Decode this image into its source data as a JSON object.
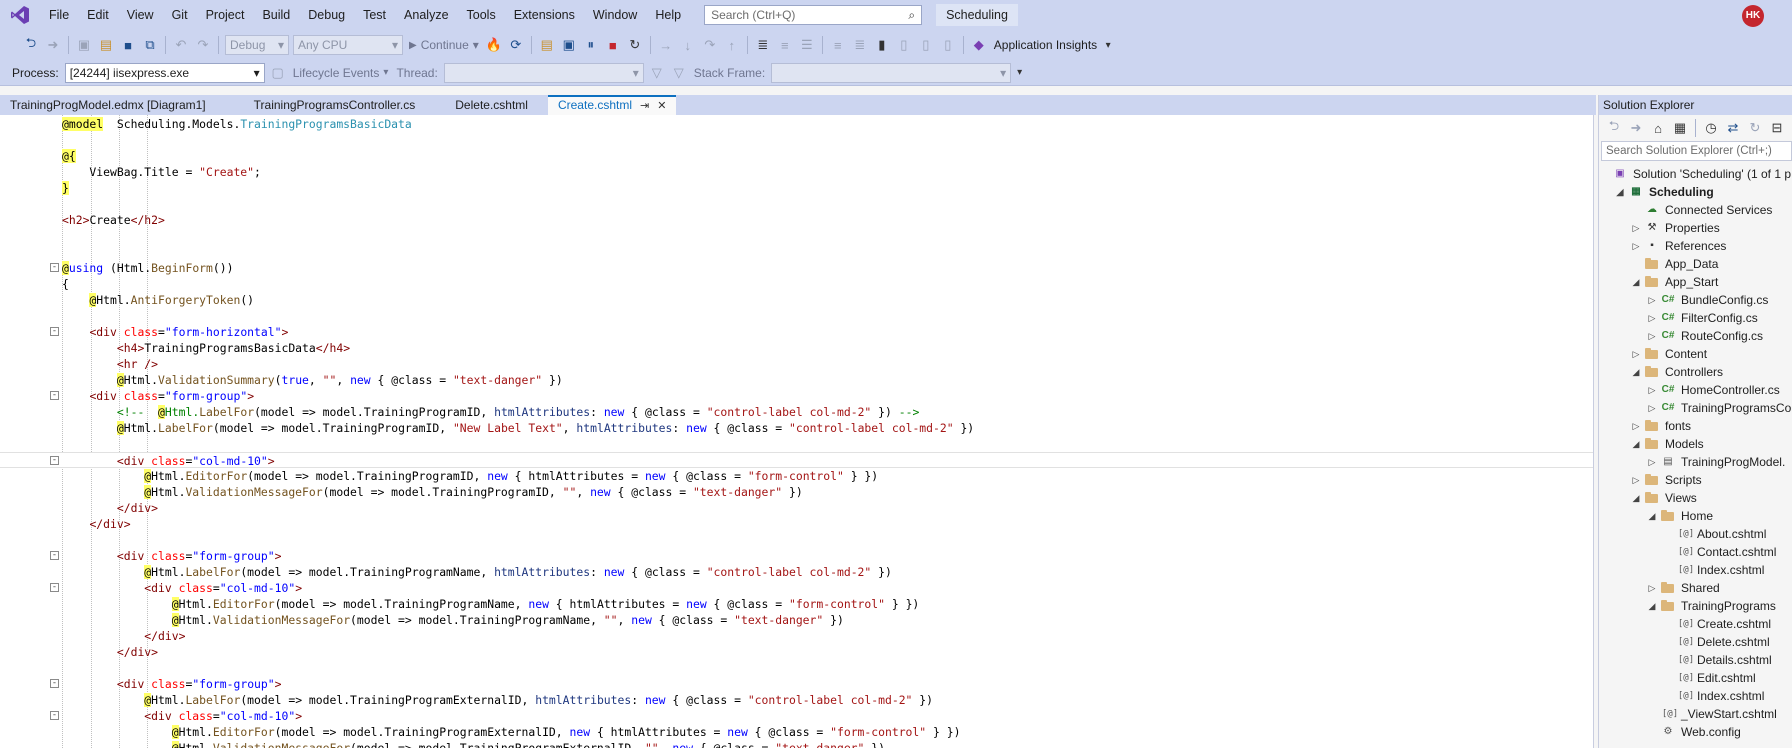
{
  "menubar": {
    "items": [
      "File",
      "Edit",
      "View",
      "Git",
      "Project",
      "Build",
      "Debug",
      "Test",
      "Analyze",
      "Tools",
      "Extensions",
      "Window",
      "Help"
    ],
    "search_placeholder": "Search (Ctrl+Q)",
    "solution_name": "Scheduling",
    "user_initials": "HK"
  },
  "toolbar": {
    "config": "Debug",
    "platform": "Any CPU",
    "continue_label": "Continue",
    "app_insights": "Application Insights",
    "process_label": "Process:",
    "process_value": "[24244] iisexpress.exe",
    "lifecycle": "Lifecycle Events",
    "thread_label": "Thread:",
    "stack_label": "Stack Frame:"
  },
  "tabs": [
    {
      "label": "TrainingProgModel.edmx [Diagram1]",
      "active": false
    },
    {
      "label": "TrainingProgramsController.cs",
      "active": false
    },
    {
      "label": "Delete.cshtml",
      "active": false
    },
    {
      "label": "Create.cshtml",
      "active": true
    }
  ],
  "tab_icons": {
    "pin": "pin-icon",
    "close": "close-icon"
  },
  "solution_explorer": {
    "title": "Solution Explorer",
    "search_placeholder": "Search Solution Explorer (Ctrl+;)",
    "nodes": [
      {
        "label": "Solution 'Scheduling' (1 of 1 p",
        "depth": 0,
        "exp": "",
        "icon": "solution"
      },
      {
        "label": "Scheduling",
        "depth": 1,
        "exp": "open",
        "icon": "project",
        "selected": true
      },
      {
        "label": "Connected Services",
        "depth": 2,
        "exp": "",
        "icon": "cloud"
      },
      {
        "label": "Properties",
        "depth": 2,
        "exp": "closed",
        "icon": "wrench"
      },
      {
        "label": "References",
        "depth": 2,
        "exp": "closed",
        "icon": "refs"
      },
      {
        "label": "App_Data",
        "depth": 2,
        "exp": "",
        "icon": "folder"
      },
      {
        "label": "App_Start",
        "depth": 2,
        "exp": "open",
        "icon": "folder"
      },
      {
        "label": "BundleConfig.cs",
        "depth": 3,
        "exp": "closed",
        "icon": "cs"
      },
      {
        "label": "FilterConfig.cs",
        "depth": 3,
        "exp": "closed",
        "icon": "cs"
      },
      {
        "label": "RouteConfig.cs",
        "depth": 3,
        "exp": "closed",
        "icon": "cs"
      },
      {
        "label": "Content",
        "depth": 2,
        "exp": "closed",
        "icon": "folder"
      },
      {
        "label": "Controllers",
        "depth": 2,
        "exp": "open",
        "icon": "folder"
      },
      {
        "label": "HomeController.cs",
        "depth": 3,
        "exp": "closed",
        "icon": "cs"
      },
      {
        "label": "TrainingProgramsCo",
        "depth": 3,
        "exp": "closed",
        "icon": "cs"
      },
      {
        "label": "fonts",
        "depth": 2,
        "exp": "closed",
        "icon": "folder"
      },
      {
        "label": "Models",
        "depth": 2,
        "exp": "open",
        "icon": "folder"
      },
      {
        "label": "TrainingProgModel.",
        "depth": 3,
        "exp": "closed",
        "icon": "edmx"
      },
      {
        "label": "Scripts",
        "depth": 2,
        "exp": "closed",
        "icon": "folder"
      },
      {
        "label": "Views",
        "depth": 2,
        "exp": "open",
        "icon": "folder"
      },
      {
        "label": "Home",
        "depth": 3,
        "exp": "open",
        "icon": "folder"
      },
      {
        "label": "About.cshtml",
        "depth": 4,
        "exp": "",
        "icon": "razor"
      },
      {
        "label": "Contact.cshtml",
        "depth": 4,
        "exp": "",
        "icon": "razor"
      },
      {
        "label": "Index.cshtml",
        "depth": 4,
        "exp": "",
        "icon": "razor"
      },
      {
        "label": "Shared",
        "depth": 3,
        "exp": "closed",
        "icon": "folder"
      },
      {
        "label": "TrainingPrograms",
        "depth": 3,
        "exp": "open",
        "icon": "folder"
      },
      {
        "label": "Create.cshtml",
        "depth": 4,
        "exp": "",
        "icon": "razor"
      },
      {
        "label": "Delete.cshtml",
        "depth": 4,
        "exp": "",
        "icon": "razor"
      },
      {
        "label": "Details.cshtml",
        "depth": 4,
        "exp": "",
        "icon": "razor"
      },
      {
        "label": "Edit.cshtml",
        "depth": 4,
        "exp": "",
        "icon": "razor"
      },
      {
        "label": "Index.cshtml",
        "depth": 4,
        "exp": "",
        "icon": "razor"
      },
      {
        "label": "_ViewStart.cshtml",
        "depth": 3,
        "exp": "",
        "icon": "razor"
      },
      {
        "label": "Web.config",
        "depth": 3,
        "exp": "",
        "icon": "config"
      }
    ]
  },
  "code_lines": [
    {
      "fold": "",
      "tokens": [
        [
          "at",
          "@model"
        ],
        [
          "",
          "  Scheduling.Models."
        ],
        [
          "type",
          "TrainingProgramsBasicData"
        ]
      ]
    },
    {
      "fold": "",
      "tokens": []
    },
    {
      "fold": "",
      "tokens": [
        [
          "at",
          "@{"
        ]
      ]
    },
    {
      "fold": "",
      "tokens": [
        [
          "",
          "    ViewBag.Title = "
        ],
        [
          "str",
          "\"Create\""
        ],
        [
          "",
          ";"
        ]
      ]
    },
    {
      "fold": "",
      "tokens": [
        [
          "at",
          "}"
        ]
      ]
    },
    {
      "fold": "",
      "tokens": []
    },
    {
      "fold": "",
      "tokens": [
        [
          "tag",
          "<h2>"
        ],
        [
          "",
          "Create"
        ],
        [
          "tag",
          "</h2>"
        ]
      ]
    },
    {
      "fold": "",
      "tokens": []
    },
    {
      "fold": "",
      "tokens": []
    },
    {
      "fold": "-",
      "tokens": [
        [
          "at",
          "@"
        ],
        [
          "kw",
          "using"
        ],
        [
          "",
          " (Html."
        ],
        [
          "method",
          "BeginForm"
        ],
        [
          "",
          "())"
        ]
      ]
    },
    {
      "fold": "",
      "tokens": [
        [
          "",
          "{"
        ]
      ]
    },
    {
      "fold": "",
      "tokens": [
        [
          "",
          "    "
        ],
        [
          "at",
          "@"
        ],
        [
          "",
          "Html."
        ],
        [
          "method",
          "AntiForgeryToken"
        ],
        [
          "",
          "()"
        ]
      ]
    },
    {
      "fold": "",
      "tokens": []
    },
    {
      "fold": "-",
      "tokens": [
        [
          "",
          "    "
        ],
        [
          "tag",
          "<div"
        ],
        [
          "",
          " "
        ],
        [
          "attr",
          "class"
        ],
        [
          "",
          "="
        ],
        [
          "attrval",
          "\"form-horizontal\""
        ],
        [
          "tag",
          ">"
        ]
      ]
    },
    {
      "fold": "",
      "tokens": [
        [
          "",
          "        "
        ],
        [
          "tag",
          "<h4>"
        ],
        [
          "",
          "TrainingProgramsBasicData"
        ],
        [
          "tag",
          "</h4>"
        ]
      ]
    },
    {
      "fold": "",
      "tokens": [
        [
          "",
          "        "
        ],
        [
          "tag",
          "<hr />"
        ]
      ]
    },
    {
      "fold": "",
      "tokens": [
        [
          "",
          "        "
        ],
        [
          "at",
          "@"
        ],
        [
          "",
          "Html."
        ],
        [
          "method",
          "ValidationSummary"
        ],
        [
          "",
          "("
        ],
        [
          "kw",
          "true"
        ],
        [
          "",
          ", "
        ],
        [
          "str",
          "\"\""
        ],
        [
          "",
          ", "
        ],
        [
          "kw",
          "new"
        ],
        [
          "",
          " { @class = "
        ],
        [
          "str",
          "\"text-danger\""
        ],
        [
          "",
          " })"
        ]
      ]
    },
    {
      "fold": "-",
      "tokens": [
        [
          "",
          "    "
        ],
        [
          "tag",
          "<div"
        ],
        [
          "",
          " "
        ],
        [
          "attr",
          "class"
        ],
        [
          "",
          "="
        ],
        [
          "attrval",
          "\"form-group\""
        ],
        [
          "tag",
          ">"
        ]
      ]
    },
    {
      "fold": "",
      "tokens": [
        [
          "",
          "        "
        ],
        [
          "cmt",
          "<!--  "
        ],
        [
          "at",
          "@"
        ],
        [
          "cmt",
          "Html."
        ],
        [
          "method",
          "LabelFor"
        ],
        [
          "",
          "(model => model.TrainingProgramID, "
        ],
        [
          "prop",
          "htmlAttributes"
        ],
        [
          "",
          ": "
        ],
        [
          "kw",
          "new"
        ],
        [
          "",
          " { @class = "
        ],
        [
          "str",
          "\"control-label col-md-2\""
        ],
        [
          "",
          " }) "
        ],
        [
          "cmt",
          "-->"
        ]
      ]
    },
    {
      "fold": "",
      "tokens": [
        [
          "",
          "        "
        ],
        [
          "at",
          "@"
        ],
        [
          "",
          "Html."
        ],
        [
          "method",
          "LabelFor"
        ],
        [
          "",
          "(model => model.TrainingProgramID, "
        ],
        [
          "str",
          "\"New Label Text\""
        ],
        [
          "",
          ", "
        ],
        [
          "prop",
          "htmlAttributes"
        ],
        [
          "",
          ": "
        ],
        [
          "kw",
          "new"
        ],
        [
          "",
          " { @class = "
        ],
        [
          "str",
          "\"control-label col-md-2\""
        ],
        [
          "",
          " })"
        ]
      ]
    },
    {
      "fold": "",
      "tokens": []
    },
    {
      "fold": "-",
      "current": true,
      "tokens": [
        [
          "",
          "        "
        ],
        [
          "tag",
          "<div"
        ],
        [
          "",
          " "
        ],
        [
          "attr",
          "class"
        ],
        [
          "",
          "="
        ],
        [
          "attrval",
          "\"col-md-10\""
        ],
        [
          "tag",
          ">"
        ]
      ]
    },
    {
      "fold": "",
      "tokens": [
        [
          "",
          "            "
        ],
        [
          "at",
          "@"
        ],
        [
          "",
          "Html."
        ],
        [
          "method",
          "EditorFor"
        ],
        [
          "",
          "(model => model.TrainingProgramID, "
        ],
        [
          "kw",
          "new"
        ],
        [
          "",
          " { htmlAttributes = "
        ],
        [
          "kw",
          "new"
        ],
        [
          "",
          " { @class = "
        ],
        [
          "str",
          "\"form-control\""
        ],
        [
          "",
          " } })"
        ]
      ]
    },
    {
      "fold": "",
      "tokens": [
        [
          "",
          "            "
        ],
        [
          "at",
          "@"
        ],
        [
          "",
          "Html."
        ],
        [
          "method",
          "ValidationMessageFor"
        ],
        [
          "",
          "(model => model.TrainingProgramID, "
        ],
        [
          "str",
          "\"\""
        ],
        [
          "",
          ", "
        ],
        [
          "kw",
          "new"
        ],
        [
          "",
          " { @class = "
        ],
        [
          "str",
          "\"text-danger\""
        ],
        [
          "",
          " })"
        ]
      ]
    },
    {
      "fold": "",
      "tokens": [
        [
          "",
          "        "
        ],
        [
          "tag",
          "</div>"
        ]
      ]
    },
    {
      "fold": "",
      "tokens": [
        [
          "",
          "    "
        ],
        [
          "tag",
          "</div>"
        ]
      ]
    },
    {
      "fold": "",
      "tokens": []
    },
    {
      "fold": "-",
      "tokens": [
        [
          "",
          "        "
        ],
        [
          "tag",
          "<div"
        ],
        [
          "",
          " "
        ],
        [
          "attr",
          "class"
        ],
        [
          "",
          "="
        ],
        [
          "attrval",
          "\"form-group\""
        ],
        [
          "tag",
          ">"
        ]
      ]
    },
    {
      "fold": "",
      "tokens": [
        [
          "",
          "            "
        ],
        [
          "at",
          "@"
        ],
        [
          "",
          "Html."
        ],
        [
          "method",
          "LabelFor"
        ],
        [
          "",
          "(model => model.TrainingProgramName, "
        ],
        [
          "prop",
          "htmlAttributes"
        ],
        [
          "",
          ": "
        ],
        [
          "kw",
          "new"
        ],
        [
          "",
          " { @class = "
        ],
        [
          "str",
          "\"control-label col-md-2\""
        ],
        [
          "",
          " })"
        ]
      ]
    },
    {
      "fold": "-",
      "tokens": [
        [
          "",
          "            "
        ],
        [
          "tag",
          "<div"
        ],
        [
          "",
          " "
        ],
        [
          "attr",
          "class"
        ],
        [
          "",
          "="
        ],
        [
          "attrval",
          "\"col-md-10\""
        ],
        [
          "tag",
          ">"
        ]
      ]
    },
    {
      "fold": "",
      "tokens": [
        [
          "",
          "                "
        ],
        [
          "at",
          "@"
        ],
        [
          "",
          "Html."
        ],
        [
          "method",
          "EditorFor"
        ],
        [
          "",
          "(model => model.TrainingProgramName, "
        ],
        [
          "kw",
          "new"
        ],
        [
          "",
          " { htmlAttributes = "
        ],
        [
          "kw",
          "new"
        ],
        [
          "",
          " { @class = "
        ],
        [
          "str",
          "\"form-control\""
        ],
        [
          "",
          " } })"
        ]
      ]
    },
    {
      "fold": "",
      "tokens": [
        [
          "",
          "                "
        ],
        [
          "at",
          "@"
        ],
        [
          "",
          "Html."
        ],
        [
          "method",
          "ValidationMessageFor"
        ],
        [
          "",
          "(model => model.TrainingProgramName, "
        ],
        [
          "str",
          "\"\""
        ],
        [
          "",
          ", "
        ],
        [
          "kw",
          "new"
        ],
        [
          "",
          " { @class = "
        ],
        [
          "str",
          "\"text-danger\""
        ],
        [
          "",
          " })"
        ]
      ]
    },
    {
      "fold": "",
      "tokens": [
        [
          "",
          "            "
        ],
        [
          "tag",
          "</div>"
        ]
      ]
    },
    {
      "fold": "",
      "tokens": [
        [
          "",
          "        "
        ],
        [
          "tag",
          "</div>"
        ]
      ]
    },
    {
      "fold": "",
      "tokens": []
    },
    {
      "fold": "-",
      "tokens": [
        [
          "",
          "        "
        ],
        [
          "tag",
          "<div"
        ],
        [
          "",
          " "
        ],
        [
          "attr",
          "class"
        ],
        [
          "",
          "="
        ],
        [
          "attrval",
          "\"form-group\""
        ],
        [
          "tag",
          ">"
        ]
      ]
    },
    {
      "fold": "",
      "tokens": [
        [
          "",
          "            "
        ],
        [
          "at",
          "@"
        ],
        [
          "",
          "Html."
        ],
        [
          "method",
          "LabelFor"
        ],
        [
          "",
          "(model => model.TrainingProgramExternalID, "
        ],
        [
          "prop",
          "htmlAttributes"
        ],
        [
          "",
          ": "
        ],
        [
          "kw",
          "new"
        ],
        [
          "",
          " { @class = "
        ],
        [
          "str",
          "\"control-label col-md-2\""
        ],
        [
          "",
          " })"
        ]
      ]
    },
    {
      "fold": "-",
      "tokens": [
        [
          "",
          "            "
        ],
        [
          "tag",
          "<div"
        ],
        [
          "",
          " "
        ],
        [
          "attr",
          "class"
        ],
        [
          "",
          "="
        ],
        [
          "attrval",
          "\"col-md-10\""
        ],
        [
          "tag",
          ">"
        ]
      ]
    },
    {
      "fold": "",
      "tokens": [
        [
          "",
          "                "
        ],
        [
          "at",
          "@"
        ],
        [
          "",
          "Html."
        ],
        [
          "method",
          "EditorFor"
        ],
        [
          "",
          "(model => model.TrainingProgramExternalID, "
        ],
        [
          "kw",
          "new"
        ],
        [
          "",
          " { htmlAttributes = "
        ],
        [
          "kw",
          "new"
        ],
        [
          "",
          " { @class = "
        ],
        [
          "str",
          "\"form-control\""
        ],
        [
          "",
          " } })"
        ]
      ]
    },
    {
      "fold": "",
      "tokens": [
        [
          "",
          "                "
        ],
        [
          "at",
          "@"
        ],
        [
          "",
          "Html."
        ],
        [
          "method",
          "ValidationMessageFor"
        ],
        [
          "",
          "(model => model.TrainingProgramExternalID, "
        ],
        [
          "str",
          "\"\""
        ],
        [
          "",
          ", "
        ],
        [
          "kw",
          "new"
        ],
        [
          "",
          " { @class = "
        ],
        [
          "str",
          "\"text-danger\""
        ],
        [
          "",
          " })"
        ]
      ]
    }
  ],
  "colors": {
    "chrome": "#ccd5f0",
    "accent": "#0e70c0",
    "razor_highlight": "#ffff66"
  }
}
